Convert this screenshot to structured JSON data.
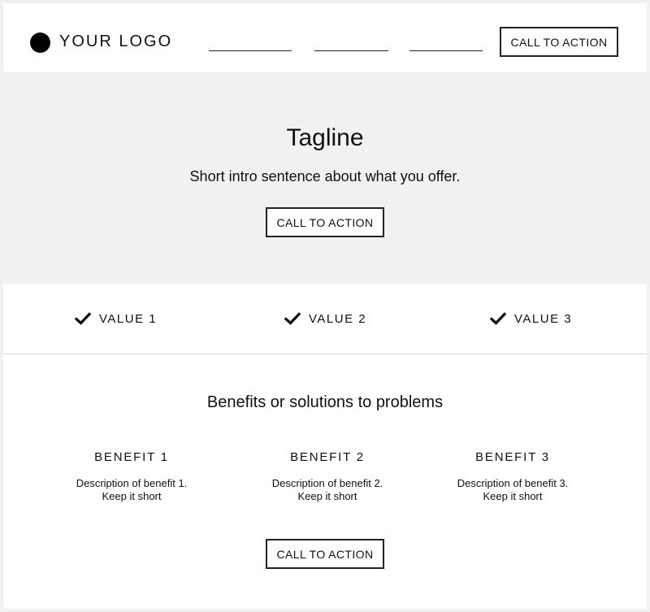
{
  "header": {
    "logo_text": "YOUR LOGO",
    "nav_items": [
      "",
      "",
      ""
    ],
    "cta_label": "CALL TO ACTION"
  },
  "hero": {
    "tagline": "Tagline",
    "intro": "Short intro sentence about what you offer.",
    "cta_label": "CALL TO ACTION",
    "background": "#f0f1f0"
  },
  "values": {
    "items": [
      {
        "label": "VALUE 1",
        "icon": "check-icon"
      },
      {
        "label": "VALUE 2",
        "icon": "check-icon"
      },
      {
        "label": "VALUE 3",
        "icon": "check-icon"
      }
    ]
  },
  "benefits": {
    "title": "Benefits or solutions to problems",
    "items": [
      {
        "title": "BENEFIT 1",
        "desc_line1": "Description of benefit 1.",
        "desc_line2": "Keep it short"
      },
      {
        "title": "BENEFIT 2",
        "desc_line1": "Description of benefit 2.",
        "desc_line2": "Keep it short"
      },
      {
        "title": "BENEFIT 3",
        "desc_line1": "Description of benefit 3.",
        "desc_line2": "Keep it short"
      }
    ],
    "cta_label": "CALL TO ACTION"
  }
}
